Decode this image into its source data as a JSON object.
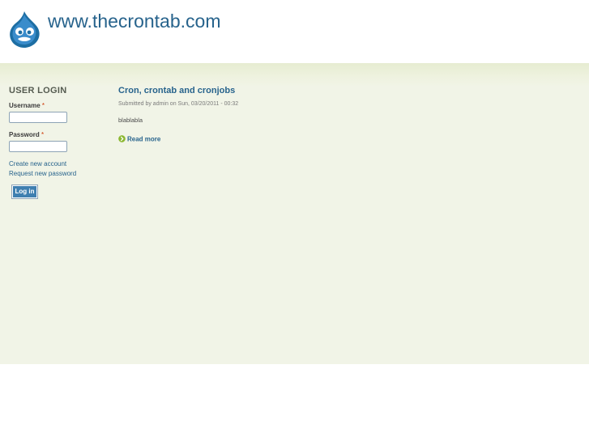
{
  "header": {
    "site_name": "www.thecrontab.com",
    "logo_icon": "drupal-drop-icon"
  },
  "sidebar": {
    "login_block": {
      "title": "USER LOGIN",
      "username_label": "Username",
      "password_label": "Password",
      "required_marker": "*",
      "username_value": "",
      "password_value": "",
      "links": [
        {
          "label": "Create new account"
        },
        {
          "label": "Request new password"
        }
      ],
      "submit_label": "Log in"
    }
  },
  "main": {
    "node": {
      "title": "Cron, crontab and cronjobs",
      "submitted": "Submitted by admin on Sun, 03/20/2011 - 00:32",
      "body": "blablabla",
      "read_more_label": "Read more",
      "read_more_icon": "chevron-right-circle-icon"
    }
  },
  "colors": {
    "link": "#27638c",
    "content_background": "#f1f4e7",
    "band": "#e6ecd1",
    "button": "#3f7fb0",
    "required": "#cc3300",
    "read_more_icon": "#8cb832"
  }
}
